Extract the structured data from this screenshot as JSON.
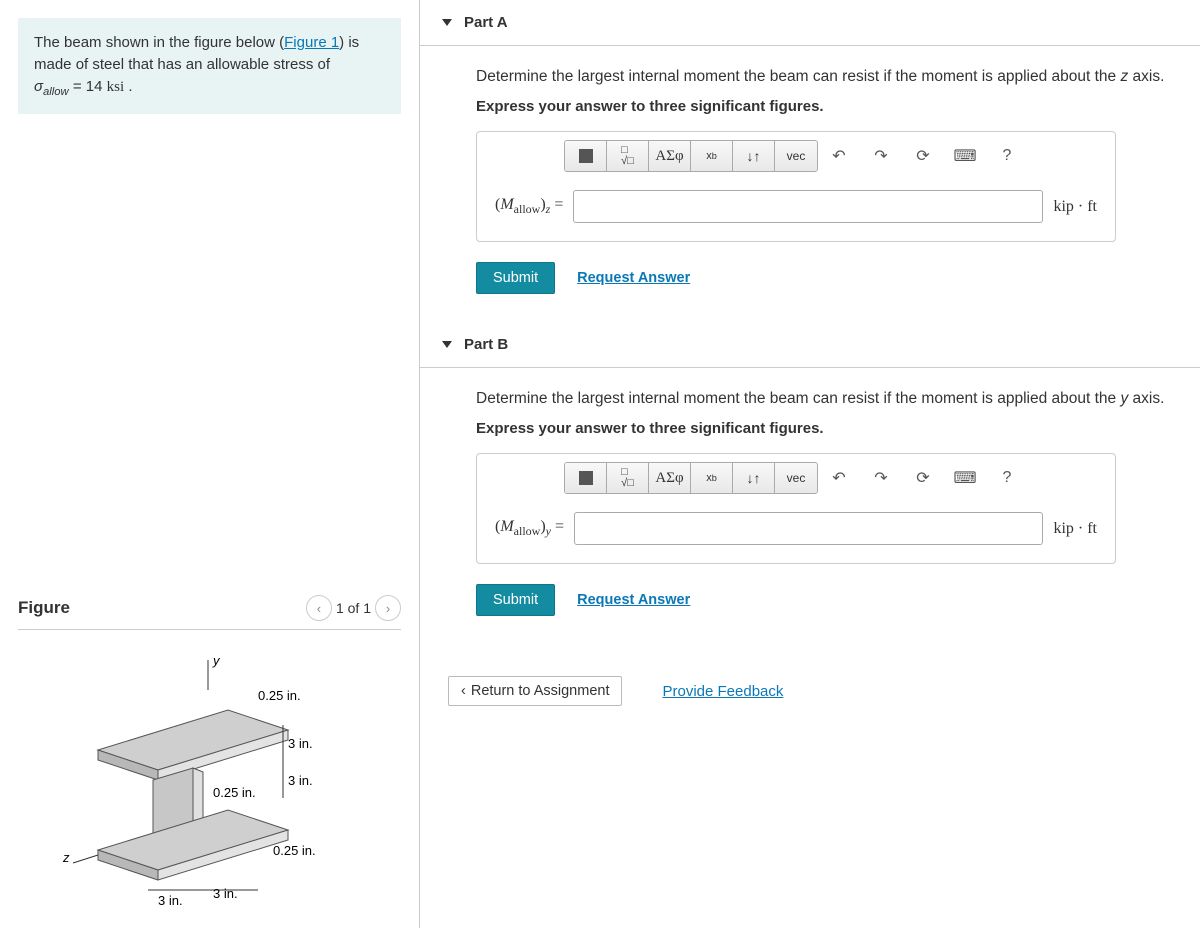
{
  "problem": {
    "text_before_link": "The beam shown in the figure below (",
    "figure_link": "Figure 1",
    "text_after_link": ") is made of steel that has an allowable stress of ",
    "sigma_label": "σ",
    "sigma_sub": "allow",
    "equals": " = ",
    "stress_value": "14",
    "stress_unit": "ksi",
    "period": " ."
  },
  "figure": {
    "title": "Figure",
    "counter": "1 of 1",
    "labels": {
      "y": "y",
      "z": "z",
      "t025a": "0.25 in.",
      "d3a": "3 in.",
      "t025b": "0.25 in.",
      "d3b": "3 in.",
      "t025c": "0.25 in.",
      "d3c": "3 in.",
      "d3d": "3 in."
    }
  },
  "parts": [
    {
      "id": "A",
      "header": "Part A",
      "prompt_before": "Determine the largest internal moment the beam can resist if the moment is applied about the ",
      "axis": "z",
      "prompt_after": " axis.",
      "instruct": "Express your answer to three significant figures.",
      "answer_label_html": "(M_{allow})_{z} =",
      "unit": "kip · ft",
      "submit": "Submit",
      "request": "Request Answer"
    },
    {
      "id": "B",
      "header": "Part B",
      "prompt_before": "Determine the largest internal moment the beam can resist if the moment is applied about the ",
      "axis": "y",
      "prompt_after": " axis.",
      "instruct": "Express your answer to three significant figures.",
      "answer_label_html": "(M_{allow})_{y} =",
      "unit": "kip · ft",
      "submit": "Submit",
      "request": "Request Answer"
    }
  ],
  "toolbar": {
    "greek": "ΑΣφ",
    "vec": "vec"
  },
  "bottom": {
    "return": "Return to Assignment",
    "feedback": "Provide Feedback"
  }
}
